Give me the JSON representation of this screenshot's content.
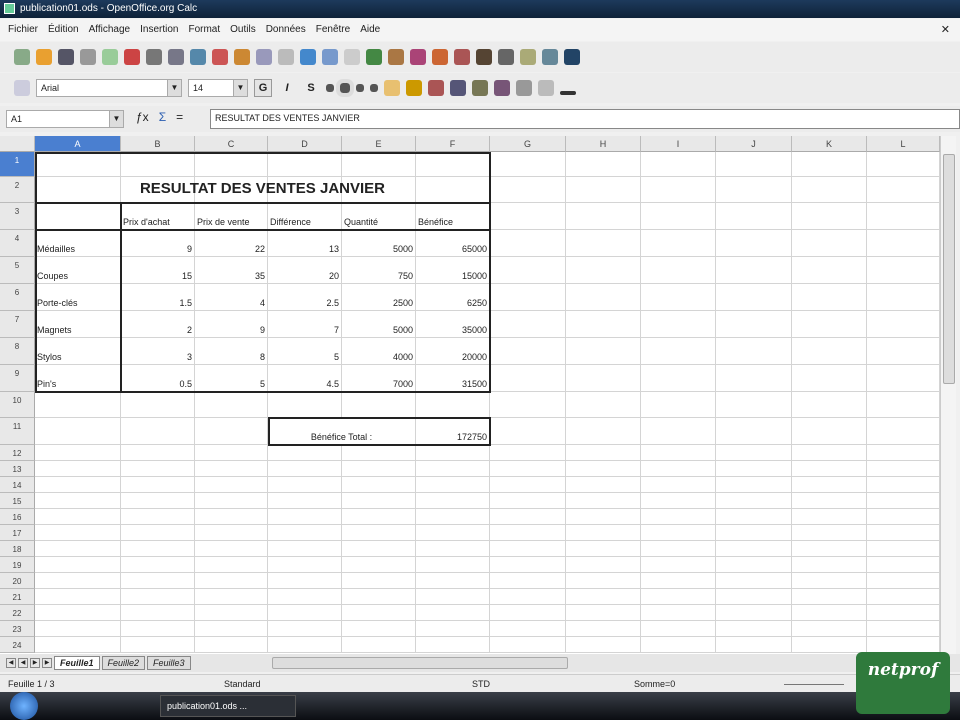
{
  "window": {
    "title": "publication01.ods - OpenOffice.org Calc"
  },
  "menu": [
    "Fichier",
    "Édition",
    "Affichage",
    "Insertion",
    "Format",
    "Outils",
    "Données",
    "Fenêtre",
    "Aide"
  ],
  "format_bar": {
    "font": "Arial",
    "size": "14",
    "bold": "G",
    "italic": "I",
    "underline": "S"
  },
  "formula_bar": {
    "cell_ref": "A1",
    "content": "RESULTAT DES VENTES JANVIER"
  },
  "columns": [
    "A",
    "B",
    "C",
    "D",
    "E",
    "F",
    "G",
    "H",
    "I",
    "J",
    "K",
    "L"
  ],
  "rows": [
    "1",
    "2",
    "3",
    "4",
    "5",
    "6",
    "7",
    "8",
    "9",
    "10",
    "11",
    "12",
    "13",
    "14",
    "15",
    "16",
    "17",
    "18",
    "19",
    "20",
    "21",
    "22",
    "23",
    "24"
  ],
  "sheet": {
    "title": "RESULTAT DES VENTES JANVIER",
    "headers": [
      "Prix d'achat",
      "Prix de vente",
      "Différence",
      "Quantité",
      "Bénéfice"
    ],
    "table": [
      {
        "item": "Médailles",
        "values": [
          "9",
          "22",
          "13",
          "5000",
          "65000"
        ]
      },
      {
        "item": "Coupes",
        "values": [
          "15",
          "35",
          "20",
          "750",
          "15000"
        ]
      },
      {
        "item": "Porte-clés",
        "values": [
          "1.5",
          "4",
          "2.5",
          "2500",
          "6250"
        ]
      },
      {
        "item": "Magnets",
        "values": [
          "2",
          "9",
          "7",
          "5000",
          "35000"
        ]
      },
      {
        "item": "Stylos",
        "values": [
          "3",
          "8",
          "5",
          "4000",
          "20000"
        ]
      },
      {
        "item": "Pin's",
        "values": [
          "0.5",
          "5",
          "4.5",
          "7000",
          "31500"
        ]
      }
    ],
    "total_label": "Bénéfice Total :",
    "total_value": "172750"
  },
  "tabs": [
    "Feuille1",
    "Feuille2",
    "Feuille3"
  ],
  "status": {
    "sheet": "Feuille 1 / 3",
    "style": "Standard",
    "mode": "STD",
    "sum": "Somme=0"
  },
  "taskbar": {
    "item": "publication01.ods ..."
  },
  "logo": "netprof"
}
